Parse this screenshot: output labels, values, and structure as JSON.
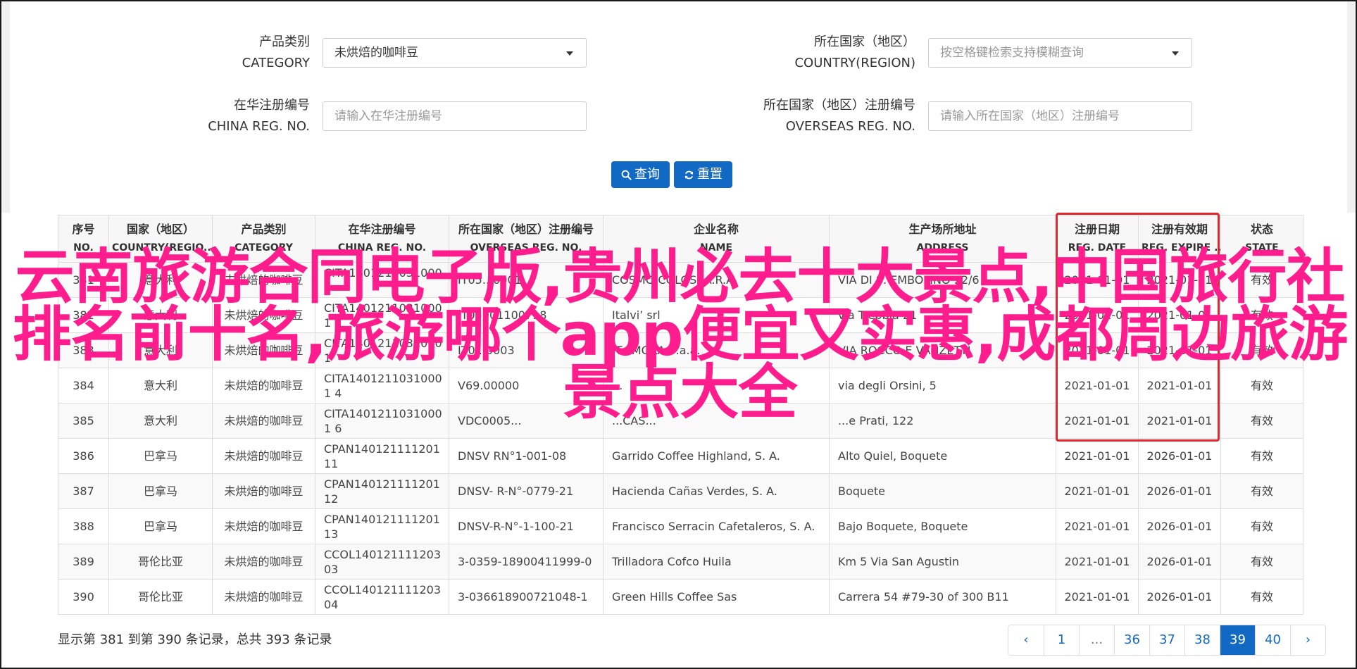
{
  "filters": {
    "category_label_cn": "产品类别",
    "category_label_en": "CATEGORY",
    "category_value": "未烘焙的咖啡豆",
    "country_label_cn": "所在国家（地区）",
    "country_label_en": "COUNTRY(REGION)",
    "country_placeholder": "按空格键检索支持模糊查询",
    "china_reg_label_cn": "在华注册编号",
    "china_reg_label_en": "CHINA REG. NO.",
    "china_reg_placeholder": "请输入在华注册编号",
    "overseas_reg_label_cn": "所在国家（地区）注册编号",
    "overseas_reg_label_en": "OVERSEAS REG. NO.",
    "overseas_reg_placeholder": "请输入所在国家（地区）注册编号",
    "search_label": "查询",
    "reset_label": "重置"
  },
  "table": {
    "headers": [
      {
        "cn": "序号",
        "en": "NO."
      },
      {
        "cn": "国家（地区）",
        "en": "COUNTRY(REGIO..."
      },
      {
        "cn": "产品类别",
        "en": "CATEGORY"
      },
      {
        "cn": "在华注册编号",
        "en": "CHINA REG. NO."
      },
      {
        "cn": "所在国家（地区）注册编号",
        "en": "OVERSEAS REG. NO."
      },
      {
        "cn": "企业名称",
        "en": "NAME"
      },
      {
        "cn": "生产场所地址",
        "en": "ADDRESS"
      },
      {
        "cn": "注册日期",
        "en": "REG. DATE"
      },
      {
        "cn": "注册有效期",
        "en": "REG. EXPIRE ..."
      },
      {
        "cn": "状态",
        "en": "STATE"
      }
    ],
    "rows": [
      {
        "no": "381",
        "country": "意大利",
        "category": "未烘焙的咖啡豆",
        "china_reg": "CITA14012110310001",
        "overseas_reg": "IT05...0001",
        "name": "COSMO COLOSSA.R.A.",
        "address": "VIA DI S. EMBOLINO 52/6",
        "reg_date": "2021-01-01",
        "expire": "2021-01-01",
        "state": "有效"
      },
      {
        "no": "382",
        "country": "意大利",
        "category": "未烘焙的咖啡豆",
        "china_reg": "CITA14012110310001",
        "overseas_reg": "IT05901100718",
        "name": "Italvi’ srl",
        "address": "via Trebbia 21",
        "reg_date": "2021-01-01",
        "expire": "2021-01-01",
        "state": "有效"
      },
      {
        "no": "383",
        "country": "意大利",
        "category": "未烘焙的咖啡豆",
        "china_reg": "CITA14012110310001",
        "overseas_reg": "IT0...0003",
        "name": "IT...MOKA S.a.a.",
        "address": "VIA ROCCO E VANZETTI",
        "reg_date": "2021-01-01",
        "expire": "2021-01-01",
        "state": "有效"
      },
      {
        "no": "384",
        "country": "意大利",
        "category": "未烘焙的咖啡豆",
        "china_reg": "CITA14012110310001 4",
        "overseas_reg": "V69.00000",
        "name": "...",
        "address": "via degli Orsini, 5",
        "reg_date": "2021-01-01",
        "expire": "2021-01-01",
        "state": "有效"
      },
      {
        "no": "385",
        "country": "意大利",
        "category": "未烘焙的咖啡豆",
        "china_reg": "CITA14012110310001 6",
        "overseas_reg": "VDC0005...",
        "name": "...CAS...",
        "address": "...e Prati, 122",
        "reg_date": "2021-01-01",
        "expire": "2021-01-01",
        "state": "有效"
      },
      {
        "no": "386",
        "country": "巴拿马",
        "category": "未烘焙的咖啡豆",
        "china_reg": "CPAN140121111201 11",
        "overseas_reg": "DNSV RN°1-001-08",
        "name": "Garrido Coffee Highland, S. A.",
        "address": "Alto Quiel, Boquete",
        "reg_date": "2021-01-01",
        "expire": "2026-01-01",
        "state": "有效"
      },
      {
        "no": "387",
        "country": "巴拿马",
        "category": "未烘焙的咖啡豆",
        "china_reg": "CPAN140121111201 12",
        "overseas_reg": "DNSV- R-N°-0779-21",
        "name": "Hacienda Cañas Verdes, S. A.",
        "address": "Boquete",
        "reg_date": "2021-01-01",
        "expire": "2026-01-01",
        "state": "有效"
      },
      {
        "no": "388",
        "country": "巴拿马",
        "category": "未烘焙的咖啡豆",
        "china_reg": "CPAN140121111201 13",
        "overseas_reg": "DNSV-R-N°-1-100-21",
        "name": "Francisco Serracin Cafetaleros, S. A.",
        "address": "Bajo Boquete, Boquete",
        "reg_date": "2021-01-01",
        "expire": "2026-01-01",
        "state": "有效"
      },
      {
        "no": "389",
        "country": "哥伦比亚",
        "category": "未烘焙的咖啡豆",
        "china_reg": "CCOL140121111203 03",
        "overseas_reg": "3-0359-18900411999-0",
        "name": "Trilladora Cofco Huila",
        "address": "Km 5 Via San Agustin",
        "reg_date": "2021-01-01",
        "expire": "2026-01-01",
        "state": "有效"
      },
      {
        "no": "390",
        "country": "哥伦比亚",
        "category": "未烘焙的咖啡豆",
        "china_reg": "CCOL140121111203 04",
        "overseas_reg": "3-036618900721048-1",
        "name": "Green Hills Coffee Sas",
        "address": "Carrera 54 #79-30 of 300 B11",
        "reg_date": "2021-01-01",
        "expire": "2026-01-01",
        "state": "有效"
      }
    ]
  },
  "overlay_text": "云南旅游合同电子版,贵州必去十大景点,中国旅行社排名前十名,旅游哪个app便宜又实惠,成都周边旅游景点大全",
  "footer": {
    "summary": "显示第 381 到第 390 条记录，总共 393 条记录"
  },
  "pagination": {
    "items": [
      "‹",
      "1",
      "...",
      "36",
      "37",
      "38",
      "39",
      "40",
      "›"
    ],
    "active": "39"
  },
  "colors": {
    "primary": "#1169c4",
    "highlight": "#e3262b",
    "overlay": "#ff1c8d"
  }
}
